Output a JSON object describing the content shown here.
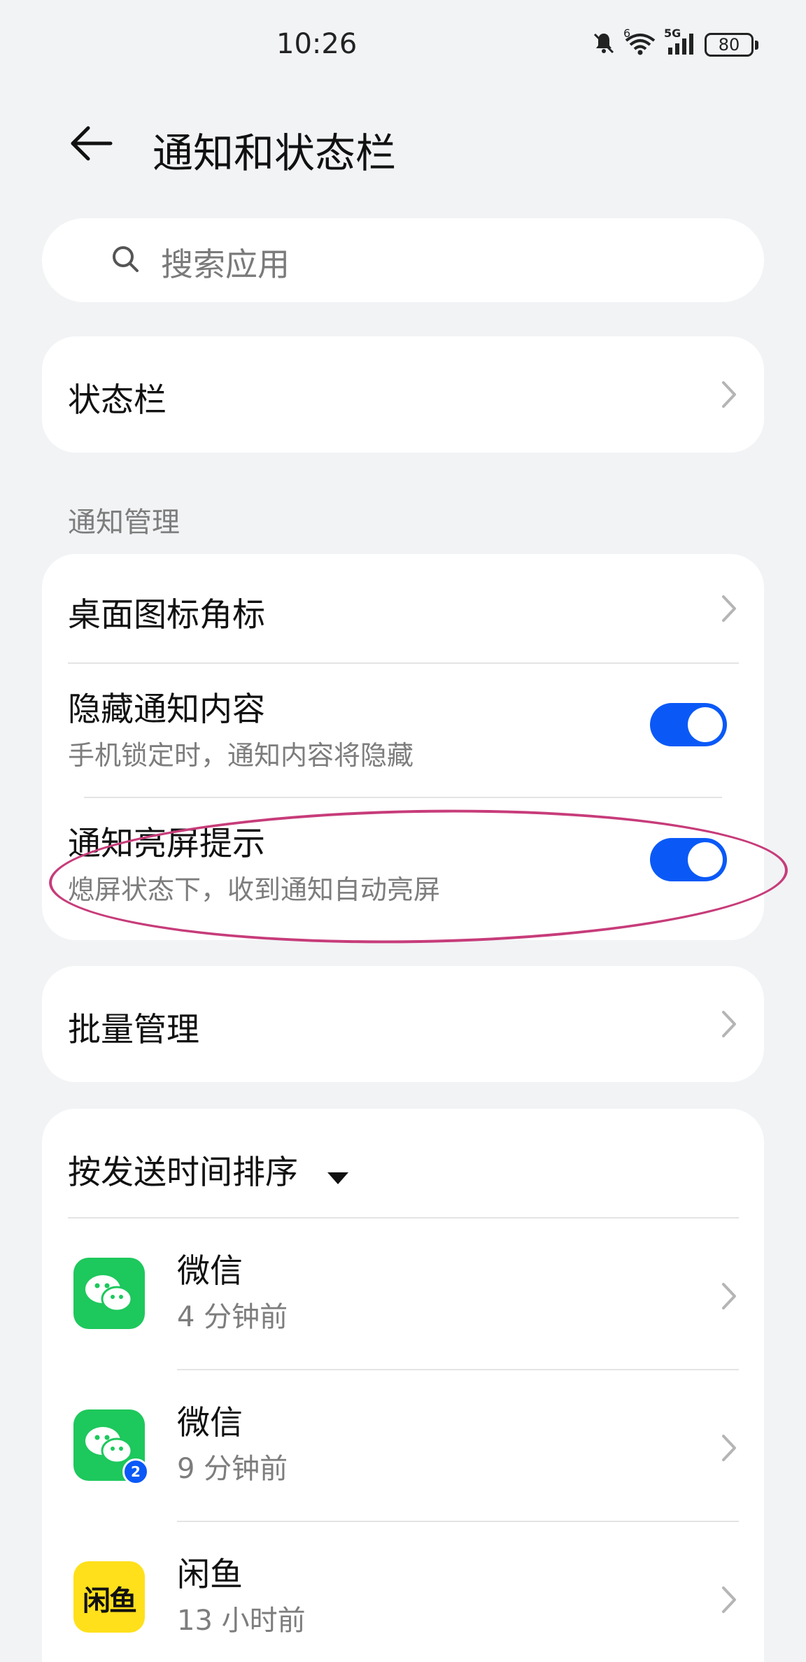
{
  "status_bar": {
    "time": "10:26",
    "signal_label_wifi": "6",
    "signal_label_cell": "5G",
    "battery": "80"
  },
  "header": {
    "title": "通知和状态栏"
  },
  "search": {
    "placeholder": "搜索应用"
  },
  "status_bar_card": {
    "label": "状态栏"
  },
  "notification_section": {
    "label": "通知管理",
    "badge_row": {
      "title": "桌面图标角标"
    },
    "hide_content": {
      "title": "隐藏通知内容",
      "subtitle": "手机锁定时，通知内容将隐藏",
      "enabled": true
    },
    "wake_screen": {
      "title": "通知亮屏提示",
      "subtitle": "熄屏状态下，收到通知自动亮屏",
      "enabled": true
    }
  },
  "batch": {
    "label": "批量管理"
  },
  "apps_section": {
    "sort_label": "按发送时间排序",
    "apps": [
      {
        "name": "微信",
        "time": "4 分钟前",
        "icon": "wechat-icon"
      },
      {
        "name": "微信",
        "time": "9 分钟前",
        "icon": "wechat-clone-icon",
        "badge": "2"
      },
      {
        "name": "闲鱼",
        "time": "13 小时前",
        "icon": "xianyu-icon",
        "icon_text": "闲鱼"
      }
    ]
  },
  "colors": {
    "accent": "#0a59f7",
    "wechat": "#1dc85c",
    "xianyu": "#ffe01b",
    "annotation": "#c73c7a"
  }
}
